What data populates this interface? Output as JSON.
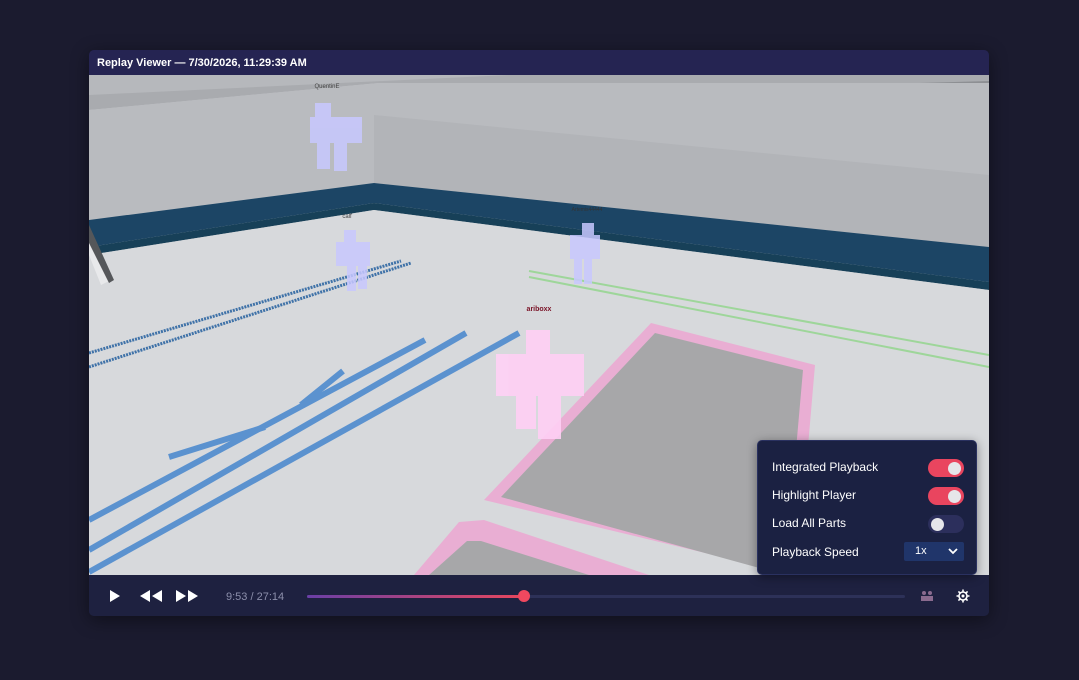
{
  "window": {
    "title": "Replay Viewer — 7/30/2026, 11:29:39 AM"
  },
  "viewport": {
    "players": [
      {
        "name": "QuentinE",
        "highlighted": false
      },
      {
        "name": "calf",
        "highlighted": false
      },
      {
        "name": "Artemis44444",
        "highlighted": false
      },
      {
        "name": "ariboxx",
        "highlighted": true
      }
    ],
    "colors": {
      "highlight": "#ffd0f5",
      "other_players": "#c8c8ff",
      "floor_lines": "#5b92cf",
      "zone_border": "#e9aed3"
    }
  },
  "controls": {
    "play_icon": "play-icon",
    "rewind_icon": "rewind-icon",
    "fast_forward_icon": "fast-forward-icon",
    "time_display": "9:53 / 27:14",
    "progress": 0.363,
    "players_icon": "players-icon",
    "settings_icon": "gear-icon"
  },
  "settings_panel": {
    "integrated_playback": {
      "label": "Integrated Playback",
      "enabled": true
    },
    "highlight_player": {
      "label": "Highlight Player",
      "enabled": true
    },
    "load_all_parts": {
      "label": "Load All Parts",
      "enabled": false
    },
    "playback_speed": {
      "label": "Playback Speed",
      "value": "1x"
    },
    "accent_color": "#e9455f"
  }
}
